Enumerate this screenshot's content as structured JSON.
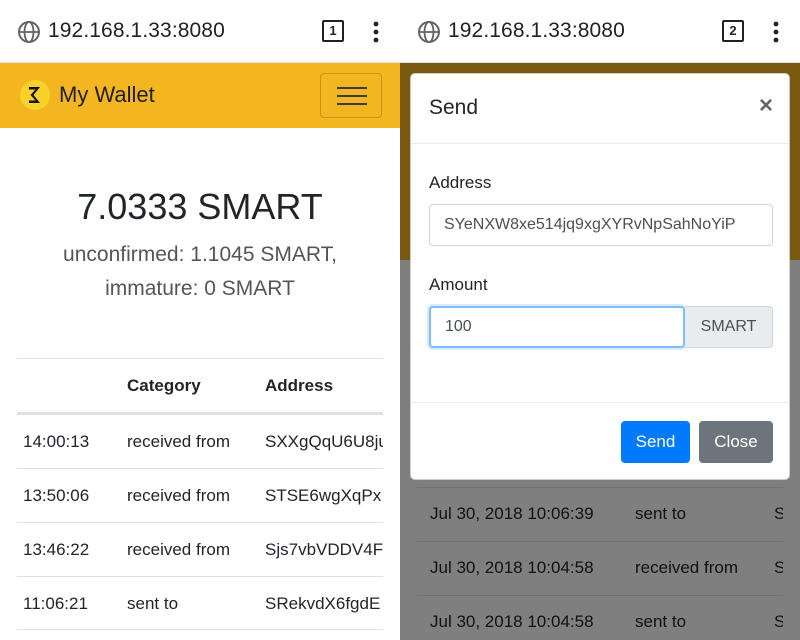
{
  "left": {
    "url": "192.168.1.33:8080",
    "tab_count": "1",
    "brand": "My Wallet",
    "balance": "7.0333 SMART",
    "unconfirmed": "unconfirmed: 1.1045 SMART,",
    "immature": "immature: 0 SMART",
    "table": {
      "headers": [
        "",
        "Category",
        "Address"
      ],
      "rows": [
        {
          "time": "14:00:13",
          "category": "received from",
          "address": "SXXgQqU6U8ju"
        },
        {
          "time": "13:50:06",
          "category": "received from",
          "address": "STSE6wgXqPx"
        },
        {
          "time": "13:46:22",
          "category": "received from",
          "address": "Sjs7vbVDDV4F"
        },
        {
          "time": "11:06:21",
          "category": "sent to",
          "address": "SRekvdX6fgdE"
        }
      ]
    }
  },
  "right": {
    "url": "192.168.1.33:8080",
    "tab_count": "2",
    "modal": {
      "title": "Send",
      "close_symbol": "×",
      "address_label": "Address",
      "address_value": "SYeNXW8xe514jq9xgXYRvNpSahNoYiP",
      "amount_label": "Amount",
      "amount_value": "100",
      "currency": "SMART",
      "send_label": "Send",
      "close_label": "Close"
    },
    "background_rows": [
      {
        "date": "Jul 30, 2018 10:06:39",
        "category": "sent to",
        "address": "S"
      },
      {
        "date": "Jul 30, 2018 10:04:58",
        "category": "received from",
        "address": "S"
      },
      {
        "date": "Jul 30, 2018 10:04:58",
        "category": "sent to",
        "address": "S"
      }
    ]
  },
  "icons": {
    "globe": "globe-icon",
    "menu": "kebab-menu-icon",
    "logo": "smartcash-logo-icon",
    "hamburger": "hamburger-icon"
  },
  "colors": {
    "navbar": "#f3b620",
    "primary": "#007bff",
    "secondary": "#6c757d"
  }
}
